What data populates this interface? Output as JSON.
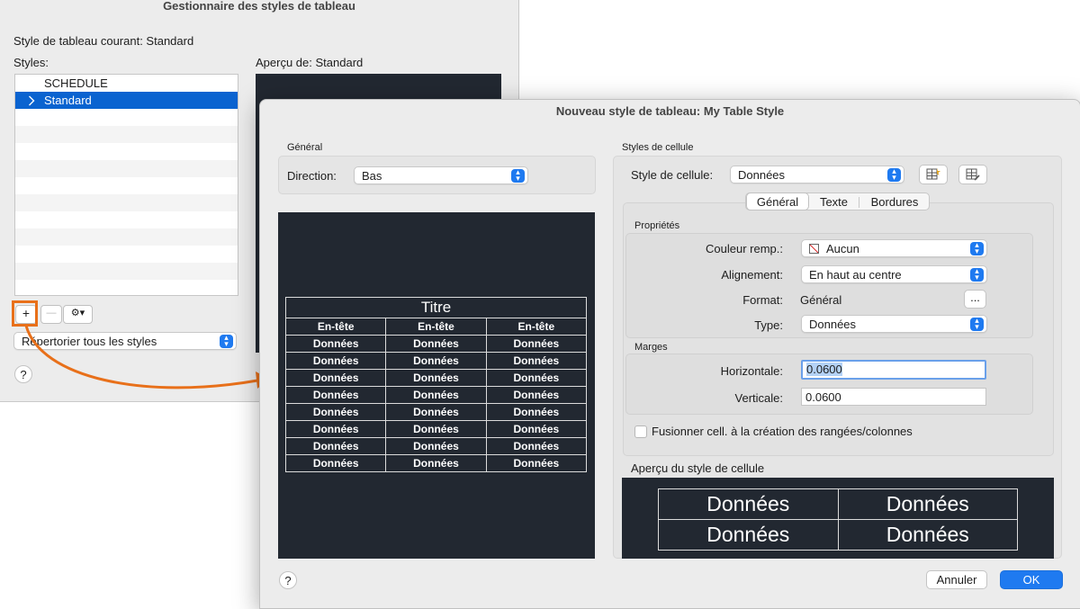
{
  "manager": {
    "title": "Gestionnaire des styles de tableau",
    "current_style": "Style de tableau courant: Standard",
    "styles_label": "Styles:",
    "preview_label": "Aperçu de: Standard",
    "styles": [
      "SCHEDULE",
      "Standard"
    ],
    "add": "+",
    "remove": "—",
    "gear": "⚙▾",
    "list_filter": "Répertorier tous les styles",
    "help": "?"
  },
  "dialog": {
    "title": "Nouveau style de tableau: My Table Style",
    "general_label": "Général",
    "direction_label": "Direction:",
    "direction_value": "Bas",
    "table_preview": {
      "title": "Titre",
      "headers": [
        "En-tête",
        "En-tête",
        "En-tête"
      ],
      "cell": "Données"
    },
    "cell_styles_label": "Styles de cellule",
    "cell_style_label": "Style de cellule:",
    "cell_style_value": "Données",
    "tabs": [
      "Général",
      "Texte",
      "Bordures"
    ],
    "properties_label": "Propriétés",
    "fill_color_label": "Couleur remp.:",
    "fill_color_value": "Aucun",
    "alignment_label": "Alignement:",
    "alignment_value": "En haut au centre",
    "format_label": "Format:",
    "format_value": "Général",
    "format_button": "...",
    "type_label": "Type:",
    "type_value": "Données",
    "margins_label": "Marges",
    "horizontal_label": "Horizontale:",
    "horizontal_value": "0.0600",
    "vertical_label": "Verticale:",
    "vertical_value": "0.0600",
    "merge_label": "Fusionner cell. à la création des rangées/colonnes",
    "cell_preview_label": "Aperçu du style de cellule",
    "cell_preview_text": "Données",
    "help": "?",
    "cancel": "Annuler",
    "ok": "OK"
  },
  "colors": {
    "accent": "#1f7af0",
    "selection": "#0a63d0",
    "highlight": "#e8701a",
    "preview_bg": "#222831"
  }
}
